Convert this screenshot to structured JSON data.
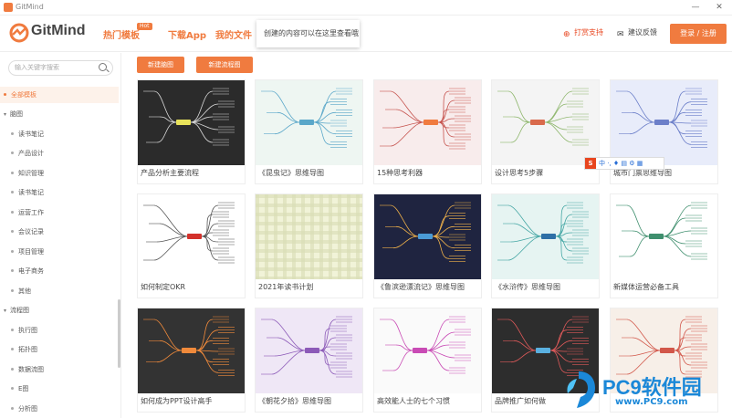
{
  "window": {
    "title": "GitMind",
    "minimize": "—",
    "close": "✕"
  },
  "header": {
    "brand": "GitMind",
    "nav": [
      {
        "label": "热门模板",
        "badge": "Hot"
      },
      {
        "label": "下载App"
      },
      {
        "label": "我的文件"
      }
    ],
    "tooltip": "创建的内容可以在这里查看哦！",
    "links": {
      "community": "打赏支持",
      "feedback": "建议反馈"
    },
    "login_label": "登录 / 注册",
    "colors": {
      "accent": "#f07b3f",
      "accent_red": "#e8451e"
    }
  },
  "sidebar": {
    "search_placeholder": "输入关键字搜索",
    "all_templates": "全部模板",
    "group1": "脑图",
    "group1_items": [
      "读书笔记",
      "产品设计",
      "知识管理",
      "读书笔记",
      "运营工作",
      "会议记录",
      "项目管理",
      "电子商务",
      "其他"
    ],
    "group2": "流程图",
    "group2_items": [
      "执行图",
      "拓扑图",
      "数据流图",
      "E图",
      "分析图"
    ]
  },
  "main": {
    "new_mindmap": "新建脑图",
    "new_flowchart": "新建流程图",
    "cards": [
      {
        "caption": "产品分析主要流程",
        "style": "dark"
      },
      {
        "caption": "《昆虫记》思维导图",
        "style": "mint"
      },
      {
        "caption": "15种思考利器",
        "style": "pink"
      },
      {
        "caption": "设计思考5步骤",
        "style": "light"
      },
      {
        "caption": "城市门票思维导图",
        "style": "lavender"
      },
      {
        "caption": "如何制定OKR",
        "style": "white"
      },
      {
        "caption": "2021年读书计划",
        "style": "plaid"
      },
      {
        "caption": "《鲁滨逊漂流记》思维导图",
        "style": "navy"
      },
      {
        "caption": "《水浒传》思维导图",
        "style": "mint2"
      },
      {
        "caption": "新媒体运营必备工具",
        "style": "white2"
      },
      {
        "caption": "如何成为PPT设计高手",
        "style": "dark2"
      },
      {
        "caption": "《朝花夕拾》思维导图",
        "style": "lavender2"
      },
      {
        "caption": "高效能人士的七个习惯",
        "style": "white3"
      },
      {
        "caption": "品牌推广如何做",
        "style": "dark3"
      },
      {
        "caption": "",
        "style": "cream"
      }
    ]
  },
  "ime_toolbar": {
    "logo": "S",
    "text": "中 ·, ♦ ▤ ⚙ ▦"
  },
  "watermark": {
    "line1": "PC9软件园",
    "line2": "www.PC9.com"
  }
}
